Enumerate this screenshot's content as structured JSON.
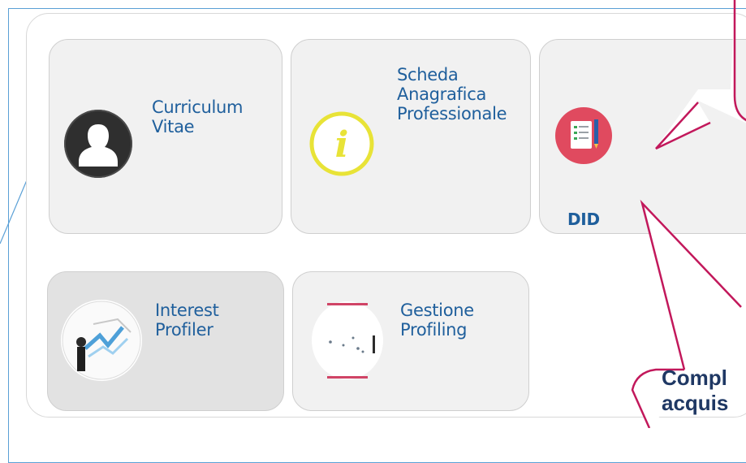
{
  "tiles": {
    "cv": {
      "line1": "Curriculum",
      "line2": "Vitae",
      "icon": "user-silhouette-icon"
    },
    "scheda": {
      "line1": "Scheda",
      "line2": "Anagrafica",
      "line3": "Professionale",
      "icon": "info-icon"
    },
    "did": {
      "label": "DID",
      "icon": "checklist-document-icon"
    },
    "interest": {
      "line1": "Interest",
      "line2": "Profiler",
      "icon": "profiler-chart-icon"
    },
    "gestione": {
      "line1": "Gestione",
      "line2": "Profiling",
      "icon": "profiling-scatter-icon"
    }
  },
  "callout": {
    "line1": "Compl",
    "line2": "acquis"
  },
  "colors": {
    "frame": "#5aa0d6",
    "callout_stroke": "#c2185b",
    "label": "#1f5f9c",
    "callout_text": "#1f3864"
  }
}
